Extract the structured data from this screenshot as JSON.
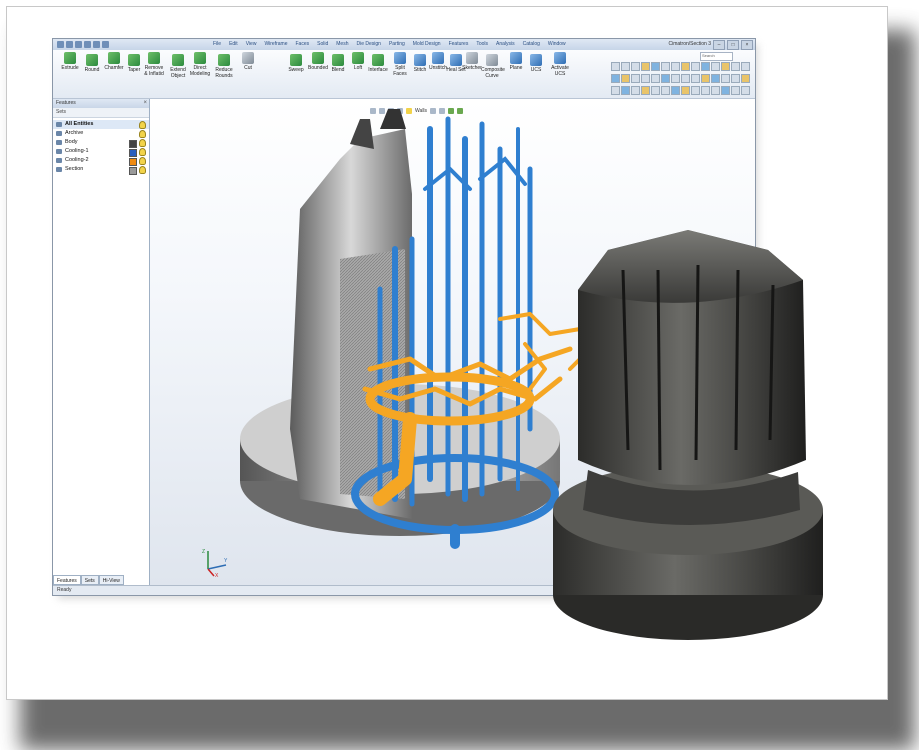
{
  "app": {
    "title": "Cimatron/Section 3",
    "menu": [
      "File",
      "Edit",
      "View",
      "Wireframe",
      "Faces",
      "Solid",
      "Mesh",
      "Die Design",
      "Parting",
      "Mold Design",
      "Features",
      "Tools",
      "Analysis",
      "Catalog",
      "Window"
    ],
    "search_placeholder": "Search"
  },
  "ribbon": {
    "buttons": [
      {
        "label": "Extrude",
        "icon": "extrude-icon",
        "tone": "green"
      },
      {
        "label": "Round",
        "icon": "round-icon",
        "tone": "green"
      },
      {
        "label": "Chamfer",
        "icon": "chamfer-icon",
        "tone": "green"
      },
      {
        "label": "Taper",
        "icon": "taper-icon",
        "tone": "green"
      },
      {
        "label": "Remove & Inflatid",
        "icon": "remove-inflate-icon",
        "tone": "green"
      },
      {
        "label": "Extend Object",
        "icon": "extend-object-icon",
        "tone": "green"
      },
      {
        "label": "Direct Modeling",
        "icon": "direct-modeling-icon",
        "tone": "green"
      },
      {
        "label": "Reduce Rounds",
        "icon": "reduce-rounds-icon",
        "tone": "green"
      },
      {
        "label": "Cut",
        "icon": "cut-icon",
        "tone": "gray"
      },
      {
        "label": "Sweep",
        "icon": "sweep-icon",
        "tone": "green"
      },
      {
        "label": "Bounded",
        "icon": "bounded-icon",
        "tone": "green"
      },
      {
        "label": "Blend",
        "icon": "blend-icon",
        "tone": "green"
      },
      {
        "label": "Loft",
        "icon": "loft-icon",
        "tone": "green"
      },
      {
        "label": "Interface",
        "icon": "interface-icon",
        "tone": "green"
      },
      {
        "label": "Split Faces",
        "icon": "split-faces-icon",
        "tone": "blue"
      },
      {
        "label": "Stitch",
        "icon": "stitch-icon",
        "tone": "blue"
      },
      {
        "label": "Unstitch",
        "icon": "unstitch-icon",
        "tone": "blue"
      },
      {
        "label": "Heal Set",
        "icon": "heal-set-icon",
        "tone": "blue"
      },
      {
        "label": "Sketcher",
        "icon": "sketcher-icon",
        "tone": "gray"
      },
      {
        "label": "Composite Curve",
        "icon": "composite-curve-icon",
        "tone": "gray"
      },
      {
        "label": "Plane",
        "icon": "plane-icon",
        "tone": "blue"
      },
      {
        "label": "UCS",
        "icon": "ucs-icon",
        "tone": "blue"
      },
      {
        "label": "Activate UCS",
        "icon": "activate-ucs-icon",
        "tone": "blue"
      }
    ]
  },
  "panel": {
    "title": "Features",
    "sets_label": "Sets",
    "items": [
      {
        "label": "All Entities",
        "swatch": "",
        "selected": true
      },
      {
        "label": "Archive",
        "swatch": ""
      },
      {
        "label": "Body",
        "swatch": "#444444"
      },
      {
        "label": "Cooling-1",
        "swatch": "#2a5fbf"
      },
      {
        "label": "Cooling-2",
        "swatch": "#f08a10"
      },
      {
        "label": "Section",
        "swatch": "#9a9a9a"
      }
    ],
    "tabs": [
      "Features",
      "Sets",
      "Hi-View"
    ]
  },
  "viewport": {
    "mode_label": "Walls"
  },
  "status": {
    "text": "Ready"
  },
  "colors": {
    "cooling_blue": "#2f7fd0",
    "cooling_orange": "#f5a623",
    "body_gray": "#9a9a9a",
    "photo_metal": "#4a4a48"
  }
}
